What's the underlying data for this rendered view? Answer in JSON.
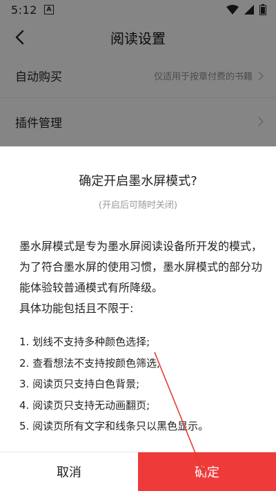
{
  "status_bar": {
    "time": "5:12",
    "notif_glyph": "A"
  },
  "header": {
    "title": "阅读设置"
  },
  "settings": [
    {
      "label": "自动购买",
      "hint": "仅适用于按章付费的书籍"
    },
    {
      "label": "插件管理",
      "hint": ""
    }
  ],
  "dialog": {
    "title": "确定开启墨水屏模式?",
    "subtitle": "(开启后可随时关闭)",
    "body_lines": [
      "墨水屏模式是专为墨水屏阅读设备所开发的模式，",
      "为了符合墨水屏的使用习惯，墨水屏模式的部分功",
      "能体验较普通模式有所降级。",
      "具体功能包括且不限于:"
    ],
    "items": [
      "1. 划线不支持多种颜色选择;",
      "2. 查看想法不支持按颜色筛选;",
      "3. 阅读页只支持白色背景;",
      "4. 阅读页只支持无动画翻页;",
      "5. 阅读页所有文字和线条只以黑色显示。"
    ],
    "cancel_label": "取消",
    "confirm_label": "确定"
  },
  "colors": {
    "accent": "#ef3a3a",
    "annotation_arrow": "#e53935"
  }
}
